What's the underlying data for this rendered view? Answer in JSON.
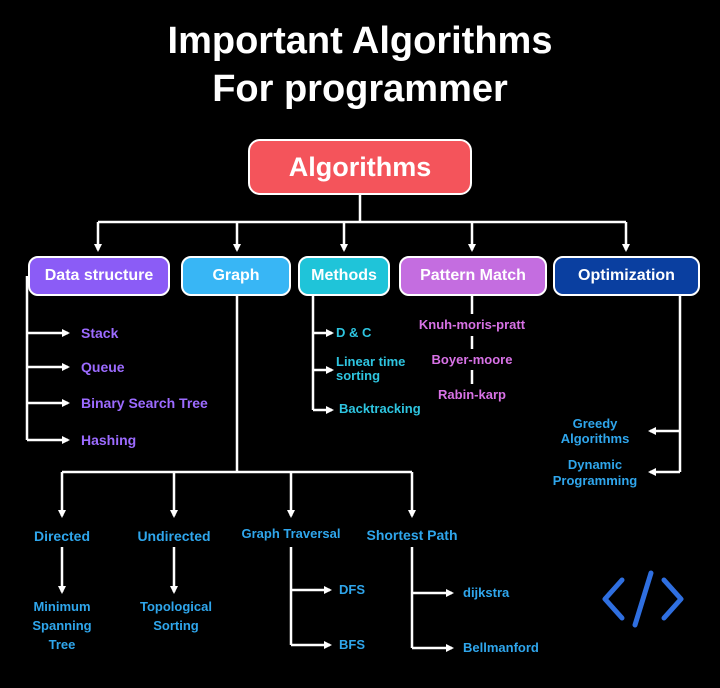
{
  "title": {
    "line1": "Important Algorithms",
    "line2": "For programmer"
  },
  "root": {
    "label": "Algorithms",
    "color": "#f4545b"
  },
  "categories": [
    {
      "label": "Data structure",
      "color": "#8b5cf6"
    },
    {
      "label": "Graph",
      "color": "#38b6f5"
    },
    {
      "label": "Methods",
      "color": "#1fc4d9"
    },
    {
      "label": "Pattern Match",
      "color": "#c46de0"
    },
    {
      "label": "Optimization",
      "color": "#0a3fa0"
    }
  ],
  "data_structure": {
    "items": [
      "Stack",
      "Queue",
      "Binary Search Tree",
      "Hashing"
    ]
  },
  "methods": {
    "items": [
      "D & C",
      {
        "line1": "Linear time",
        "line2": "sorting"
      },
      "Backtracking"
    ]
  },
  "pattern_match": {
    "items": [
      "Knuh-moris-pratt",
      "Boyer-moore",
      "Rabin-karp"
    ]
  },
  "optimization": {
    "items": [
      {
        "line1": "Greedy",
        "line2": "Algorithms"
      },
      {
        "line1": "Dynamic",
        "line2": "Programming"
      }
    ]
  },
  "graph": {
    "directed": {
      "label": "Directed",
      "child": {
        "line1": "Minimum",
        "line2": "Spanning",
        "line3": "Tree"
      }
    },
    "undirected": {
      "label": "Undirected",
      "child": {
        "line1": "Topological",
        "line2": "Sorting"
      }
    },
    "traversal": {
      "label": "Graph Traversal",
      "children": [
        "DFS",
        "BFS"
      ]
    },
    "shortest_path": {
      "label": "Shortest Path",
      "children": [
        "dijkstra",
        "Bellmanford"
      ]
    }
  },
  "icons": {
    "code": "code-brackets-icon"
  }
}
